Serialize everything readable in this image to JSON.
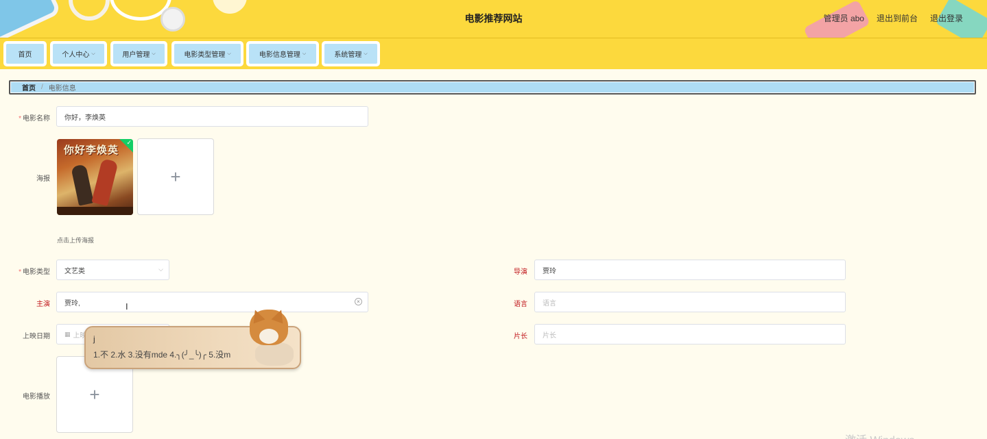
{
  "header": {
    "title": "电影推荐网站",
    "links": [
      "管理员 abo",
      "退出到前台",
      "退出登录"
    ]
  },
  "nav": {
    "items": [
      {
        "label": "首页",
        "dropdown": false
      },
      {
        "label": "个人中心",
        "dropdown": true
      },
      {
        "label": "用户管理",
        "dropdown": true
      },
      {
        "label": "电影类型管理",
        "dropdown": true
      },
      {
        "label": "电影信息管理",
        "dropdown": true
      },
      {
        "label": "系统管理",
        "dropdown": true
      }
    ]
  },
  "breadcrumb": {
    "home": "首页",
    "separator": "/",
    "current": "电影信息"
  },
  "form": {
    "name": {
      "label": "电影名称",
      "value": "你好，李焕英"
    },
    "poster": {
      "label": "海报",
      "poster_text": "你好李焕英",
      "hint": "点击上传海报"
    },
    "type": {
      "label": "电影类型",
      "value": "文艺类"
    },
    "director": {
      "label": "导演",
      "value": "贾玲"
    },
    "actors": {
      "label": "主演",
      "value": "贾玲,"
    },
    "language": {
      "label": "语言",
      "placeholder": "语言"
    },
    "release_date": {
      "label": "上映日期",
      "placeholder": "上映"
    },
    "duration": {
      "label": "片长",
      "placeholder": "片长"
    },
    "video": {
      "label": "电影播放"
    }
  },
  "ime": {
    "typed": "j",
    "candidates": "1.不  2.水  3.没有mde  4.╮(╯_╰)╭  5.没m"
  },
  "icons": {
    "plus": "+",
    "clear": "×",
    "chevron": "⌵",
    "calendar": "▦",
    "check": "✓",
    "text-cursor": "I"
  },
  "watermark": "激活 Windows",
  "colors": {
    "header_bg": "#fcd93d",
    "nav_item_bg": "#b9e2f7",
    "page_bg": "#fffcee",
    "required": "#f56c6c",
    "label_red": "#c0161b"
  }
}
